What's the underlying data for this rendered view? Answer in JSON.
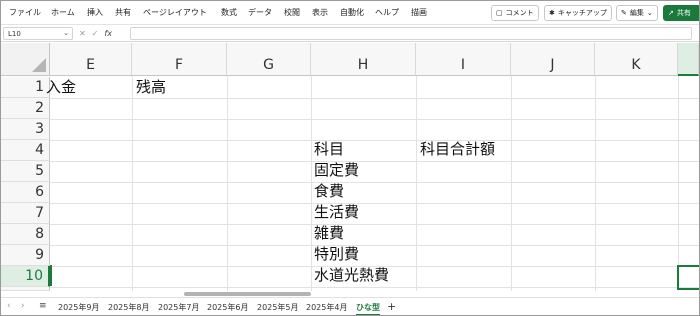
{
  "menu": [
    "ファイル",
    "ホーム",
    "挿入",
    "共有",
    "ページレイアウト",
    "数式",
    "データ",
    "校閲",
    "表示",
    "自動化",
    "ヘルプ",
    "描画"
  ],
  "ribbon_buttons": {
    "comment": "コメント",
    "catchup": "キャッチアップ",
    "edit": "編集",
    "share": "共有"
  },
  "formula_bar": {
    "name_box": "L10",
    "fx": "fx"
  },
  "columns": [
    "E",
    "F",
    "G",
    "H",
    "I",
    "J",
    "K"
  ],
  "rows": [
    "1",
    "2",
    "3",
    "4",
    "5",
    "6",
    "7",
    "8",
    "9",
    "10"
  ],
  "cells": {
    "E1": "入金",
    "F1": "残高",
    "H2": "科目",
    "I2": "科目合計額",
    "H3": "固定費",
    "H4": "食費",
    "H5": "生活費",
    "H6": "雑費",
    "H7": "特別費",
    "H8": "水道光熱費"
  },
  "sheet_tabs": [
    "2025年9月",
    "2025年8月",
    "2025年7月",
    "2025年6月",
    "2025年5月",
    "2025年4月",
    "ひな型"
  ],
  "active_tab": "ひな型",
  "accent_color": "#1d7a3e"
}
